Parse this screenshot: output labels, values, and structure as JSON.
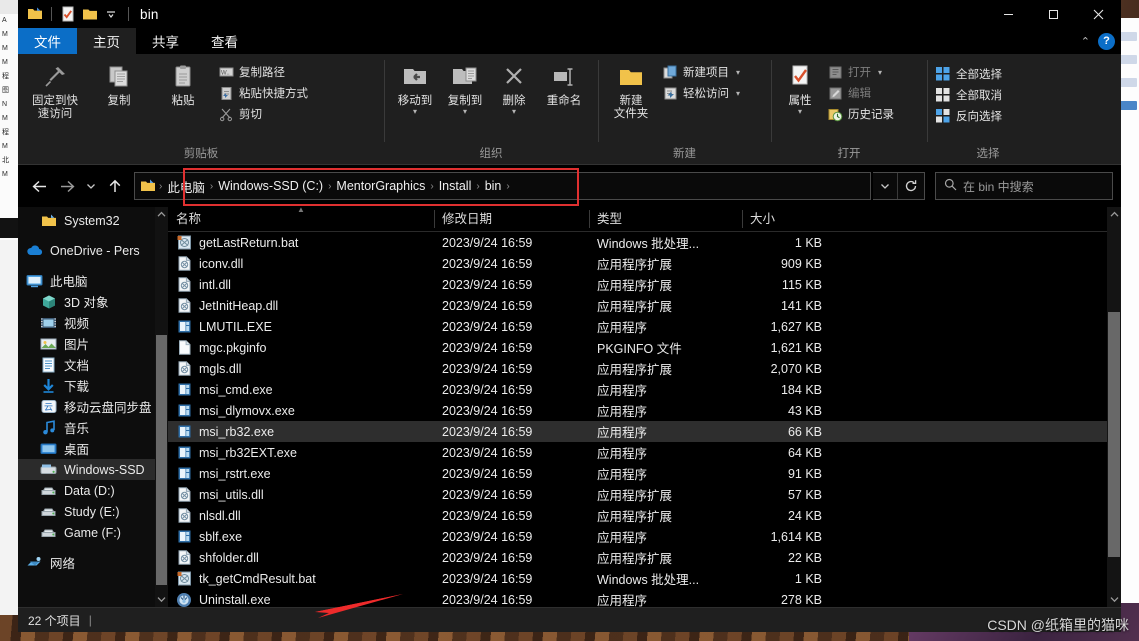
{
  "window": {
    "title": "bin",
    "controls": {
      "minimize": "—",
      "maximize": "☐",
      "close": "✕"
    },
    "ribbon_collapse": "⌃",
    "help": "?"
  },
  "tabs": [
    {
      "label": "文件",
      "kind": "file"
    },
    {
      "label": "主页",
      "kind": "active"
    },
    {
      "label": "共享",
      "kind": "normal"
    },
    {
      "label": "查看",
      "kind": "normal"
    }
  ],
  "ribbon": {
    "groups": [
      {
        "name": "剪贴板",
        "big": [
          {
            "label": "固定到快\n速访问",
            "icon": "pin-icon"
          },
          {
            "label": "复制",
            "icon": "copy-icon"
          },
          {
            "label": "粘贴",
            "icon": "paste-icon"
          }
        ],
        "small": [
          {
            "label": "复制路径",
            "icon": "copy-path-icon"
          },
          {
            "label": "粘贴快捷方式",
            "icon": "paste-shortcut-icon"
          },
          {
            "label": "剪切",
            "icon": "scissors-icon"
          }
        ]
      },
      {
        "name": "组织",
        "big": [
          {
            "label": "移动到",
            "icon": "move-to-icon",
            "caret": true
          },
          {
            "label": "复制到",
            "icon": "copy-to-icon",
            "caret": true
          },
          {
            "label": "删除",
            "icon": "delete-icon",
            "caret": true
          },
          {
            "label": "重命名",
            "icon": "rename-icon"
          }
        ],
        "small": []
      },
      {
        "name": "新建",
        "big": [
          {
            "label": "新建\n文件夹",
            "icon": "new-folder-icon"
          }
        ],
        "small": [
          {
            "label": "新建项目",
            "icon": "new-item-icon",
            "caret": true
          },
          {
            "label": "轻松访问",
            "icon": "easy-access-icon",
            "caret": true
          }
        ]
      },
      {
        "name": "打开",
        "big": [
          {
            "label": "属性",
            "icon": "properties-icon",
            "caret": true
          }
        ],
        "small": [
          {
            "label": "打开",
            "icon": "open-icon",
            "caret": true,
            "dim": true
          },
          {
            "label": "编辑",
            "icon": "edit-icon",
            "dim": true
          },
          {
            "label": "历史记录",
            "icon": "history-icon"
          }
        ]
      },
      {
        "name": "选择",
        "big": [],
        "small": [
          {
            "label": "全部选择",
            "icon": "select-all-icon"
          },
          {
            "label": "全部取消",
            "icon": "select-none-icon"
          },
          {
            "label": "反向选择",
            "icon": "invert-selection-icon"
          }
        ]
      }
    ]
  },
  "address": {
    "back": "←",
    "forward": "→",
    "recent": "⌄",
    "up": "↑",
    "crumbs": [
      "此电脑",
      "Windows-SSD (C:)",
      "MentorGraphics",
      "Install",
      "bin"
    ],
    "dropdown": "⌄",
    "refresh": "↻",
    "search_placeholder": "在 bin 中搜索",
    "search_icon": "search-icon"
  },
  "sidebar": {
    "items": [
      {
        "label": "System32",
        "icon": "folder-icon",
        "indent": 1,
        "selected": false
      },
      {
        "label": "OneDrive - Pers",
        "icon": "onedrive-icon",
        "indent": 0,
        "selected": false,
        "gap_before": true
      },
      {
        "label": "此电脑",
        "icon": "this-pc-icon",
        "indent": 0,
        "selected": false,
        "gap_before": true
      },
      {
        "label": "3D 对象",
        "icon": "3d-objects-icon",
        "indent": 1,
        "selected": false
      },
      {
        "label": "视频",
        "icon": "videos-icon",
        "indent": 1,
        "selected": false
      },
      {
        "label": "图片",
        "icon": "pictures-icon",
        "indent": 1,
        "selected": false
      },
      {
        "label": "文档",
        "icon": "documents-icon",
        "indent": 1,
        "selected": false
      },
      {
        "label": "下载",
        "icon": "downloads-icon",
        "indent": 1,
        "selected": false
      },
      {
        "label": "移动云盘同步盘",
        "icon": "cloud-sync-icon",
        "indent": 1,
        "selected": false
      },
      {
        "label": "音乐",
        "icon": "music-icon",
        "indent": 1,
        "selected": false
      },
      {
        "label": "桌面",
        "icon": "desktop-icon",
        "indent": 1,
        "selected": false
      },
      {
        "label": "Windows-SSD",
        "icon": "drive-icon",
        "indent": 1,
        "selected": true
      },
      {
        "label": "Data (D:)",
        "icon": "drive-icon",
        "indent": 1,
        "selected": false
      },
      {
        "label": "Study (E:)",
        "icon": "drive-icon",
        "indent": 1,
        "selected": false
      },
      {
        "label": "Game (F:)",
        "icon": "drive-icon",
        "indent": 1,
        "selected": false
      },
      {
        "label": "网络",
        "icon": "network-icon",
        "indent": 0,
        "selected": false,
        "gap_before": true
      }
    ],
    "scroll_up": "⌃",
    "scroll_down": "⌄"
  },
  "filelist": {
    "columns": [
      "名称",
      "修改日期",
      "类型",
      "大小"
    ],
    "sorted_column": "名称",
    "rows": [
      {
        "name": "getLastReturn.bat",
        "date": "2023/9/24 16:59",
        "type": "Windows 批处理...",
        "size": "1 KB",
        "icon": "bat-file-icon",
        "selected": false
      },
      {
        "name": "iconv.dll",
        "date": "2023/9/24 16:59",
        "type": "应用程序扩展",
        "size": "909 KB",
        "icon": "dll-file-icon",
        "selected": false
      },
      {
        "name": "intl.dll",
        "date": "2023/9/24 16:59",
        "type": "应用程序扩展",
        "size": "115 KB",
        "icon": "dll-file-icon",
        "selected": false
      },
      {
        "name": "JetInitHeap.dll",
        "date": "2023/9/24 16:59",
        "type": "应用程序扩展",
        "size": "141 KB",
        "icon": "dll-file-icon",
        "selected": false
      },
      {
        "name": "LMUTIL.EXE",
        "date": "2023/9/24 16:59",
        "type": "应用程序",
        "size": "1,627 KB",
        "icon": "exe-file-icon",
        "selected": false
      },
      {
        "name": "mgc.pkginfo",
        "date": "2023/9/24 16:59",
        "type": "PKGINFO 文件",
        "size": "1,621 KB",
        "icon": "generic-file-icon",
        "selected": false
      },
      {
        "name": "mgls.dll",
        "date": "2023/9/24 16:59",
        "type": "应用程序扩展",
        "size": "2,070 KB",
        "icon": "dll-file-icon",
        "selected": false
      },
      {
        "name": "msi_cmd.exe",
        "date": "2023/9/24 16:59",
        "type": "应用程序",
        "size": "184 KB",
        "icon": "exe-file-icon",
        "selected": false
      },
      {
        "name": "msi_dlymovx.exe",
        "date": "2023/9/24 16:59",
        "type": "应用程序",
        "size": "43 KB",
        "icon": "exe-file-icon",
        "selected": false
      },
      {
        "name": "msi_rb32.exe",
        "date": "2023/9/24 16:59",
        "type": "应用程序",
        "size": "66 KB",
        "icon": "exe-file-icon",
        "selected": true
      },
      {
        "name": "msi_rb32EXT.exe",
        "date": "2023/9/24 16:59",
        "type": "应用程序",
        "size": "64 KB",
        "icon": "exe-file-icon",
        "selected": false
      },
      {
        "name": "msi_rstrt.exe",
        "date": "2023/9/24 16:59",
        "type": "应用程序",
        "size": "91 KB",
        "icon": "exe-file-icon",
        "selected": false
      },
      {
        "name": "msi_utils.dll",
        "date": "2023/9/24 16:59",
        "type": "应用程序扩展",
        "size": "57 KB",
        "icon": "dll-file-icon",
        "selected": false
      },
      {
        "name": "nlsdl.dll",
        "date": "2023/9/24 16:59",
        "type": "应用程序扩展",
        "size": "24 KB",
        "icon": "dll-file-icon",
        "selected": false
      },
      {
        "name": "sblf.exe",
        "date": "2023/9/24 16:59",
        "type": "应用程序",
        "size": "1,614 KB",
        "icon": "exe-file-icon",
        "selected": false
      },
      {
        "name": "shfolder.dll",
        "date": "2023/9/24 16:59",
        "type": "应用程序扩展",
        "size": "22 KB",
        "icon": "dll-file-icon",
        "selected": false
      },
      {
        "name": "tk_getCmdResult.bat",
        "date": "2023/9/24 16:59",
        "type": "Windows 批处理...",
        "size": "1 KB",
        "icon": "bat-file-icon",
        "selected": false
      },
      {
        "name": "Uninstall.exe",
        "date": "2023/9/24 16:59",
        "type": "应用程序",
        "size": "278 KB",
        "icon": "uninstall-icon",
        "selected": false
      }
    ]
  },
  "statusbar": {
    "count": "22 个项目",
    "separator": "|"
  },
  "watermark": "CSDN @纸箱里的猫咪",
  "colors": {
    "accent": "#0b6ec7",
    "selection": "#2e2e2e",
    "highlight_box": "#e03030",
    "arrow": "#ee2b2b"
  }
}
